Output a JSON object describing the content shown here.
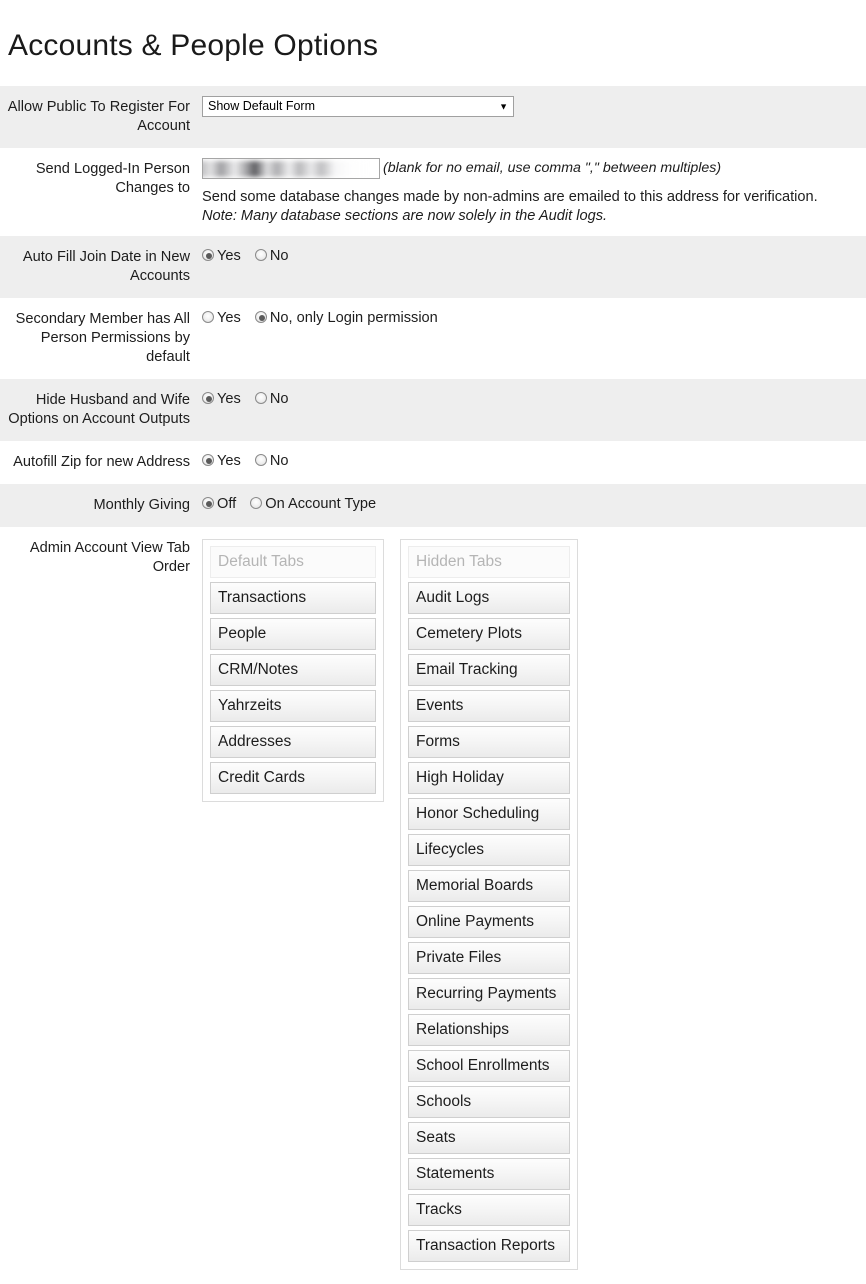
{
  "page": {
    "title": "Accounts & People Options"
  },
  "rows": [
    {
      "label": "Allow Public To Register For Account",
      "type": "select",
      "value": "Show Default Form",
      "caret": "▼"
    },
    {
      "label": "Send Logged-In Person Changes to",
      "type": "email",
      "value": "",
      "hint": "(blank for no email, use comma \",\" between multiples)",
      "description": "Send some database changes made by non-admins are emailed to this address for verification.",
      "note": "Note: Many database sections are now solely in the Audit logs."
    },
    {
      "label": "Auto Fill Join Date in New Accounts",
      "type": "radio",
      "options": [
        {
          "label": "Yes",
          "checked": true
        },
        {
          "label": "No",
          "checked": false
        }
      ]
    },
    {
      "label": "Secondary Member has All Person Permissions by default",
      "type": "radio",
      "options": [
        {
          "label": "Yes",
          "checked": false
        },
        {
          "label": "No, only Login permission",
          "checked": true
        }
      ]
    },
    {
      "label": "Hide Husband and Wife Options on Account Outputs",
      "type": "radio",
      "options": [
        {
          "label": "Yes",
          "checked": true
        },
        {
          "label": "No",
          "checked": false
        }
      ]
    },
    {
      "label": "Autofill Zip for new Address",
      "type": "radio",
      "options": [
        {
          "label": "Yes",
          "checked": true
        },
        {
          "label": "No",
          "checked": false
        }
      ]
    },
    {
      "label": "Monthly Giving",
      "type": "radio",
      "options": [
        {
          "label": "Off",
          "checked": true
        },
        {
          "label": "On Account Type",
          "checked": false
        }
      ]
    },
    {
      "label": "Admin Account View Tab Order",
      "type": "tabs",
      "default_tabs": {
        "header": "Default Tabs",
        "items": [
          "Transactions",
          "People",
          "CRM/Notes",
          "Yahrzeits",
          "Addresses",
          "Credit Cards"
        ]
      },
      "hidden_tabs": {
        "header": "Hidden Tabs",
        "items": [
          "Audit Logs",
          "Cemetery Plots",
          "Email Tracking",
          "Events",
          "Forms",
          "High Holiday",
          "Honor Scheduling",
          "Lifecycles",
          "Memorial Boards",
          "Online Payments",
          "Private Files",
          "Recurring Payments",
          "Relationships",
          "School Enrollments",
          "Schools",
          "Seats",
          "Statements",
          "Tracks",
          "Transaction Reports"
        ]
      }
    }
  ],
  "colors": {
    "row_shaded": "#eeeeee",
    "row_plain": "#ffffff",
    "text": "#1d1d1d",
    "placeholder": "#b5b5b5",
    "border": "#cfcfcf"
  }
}
